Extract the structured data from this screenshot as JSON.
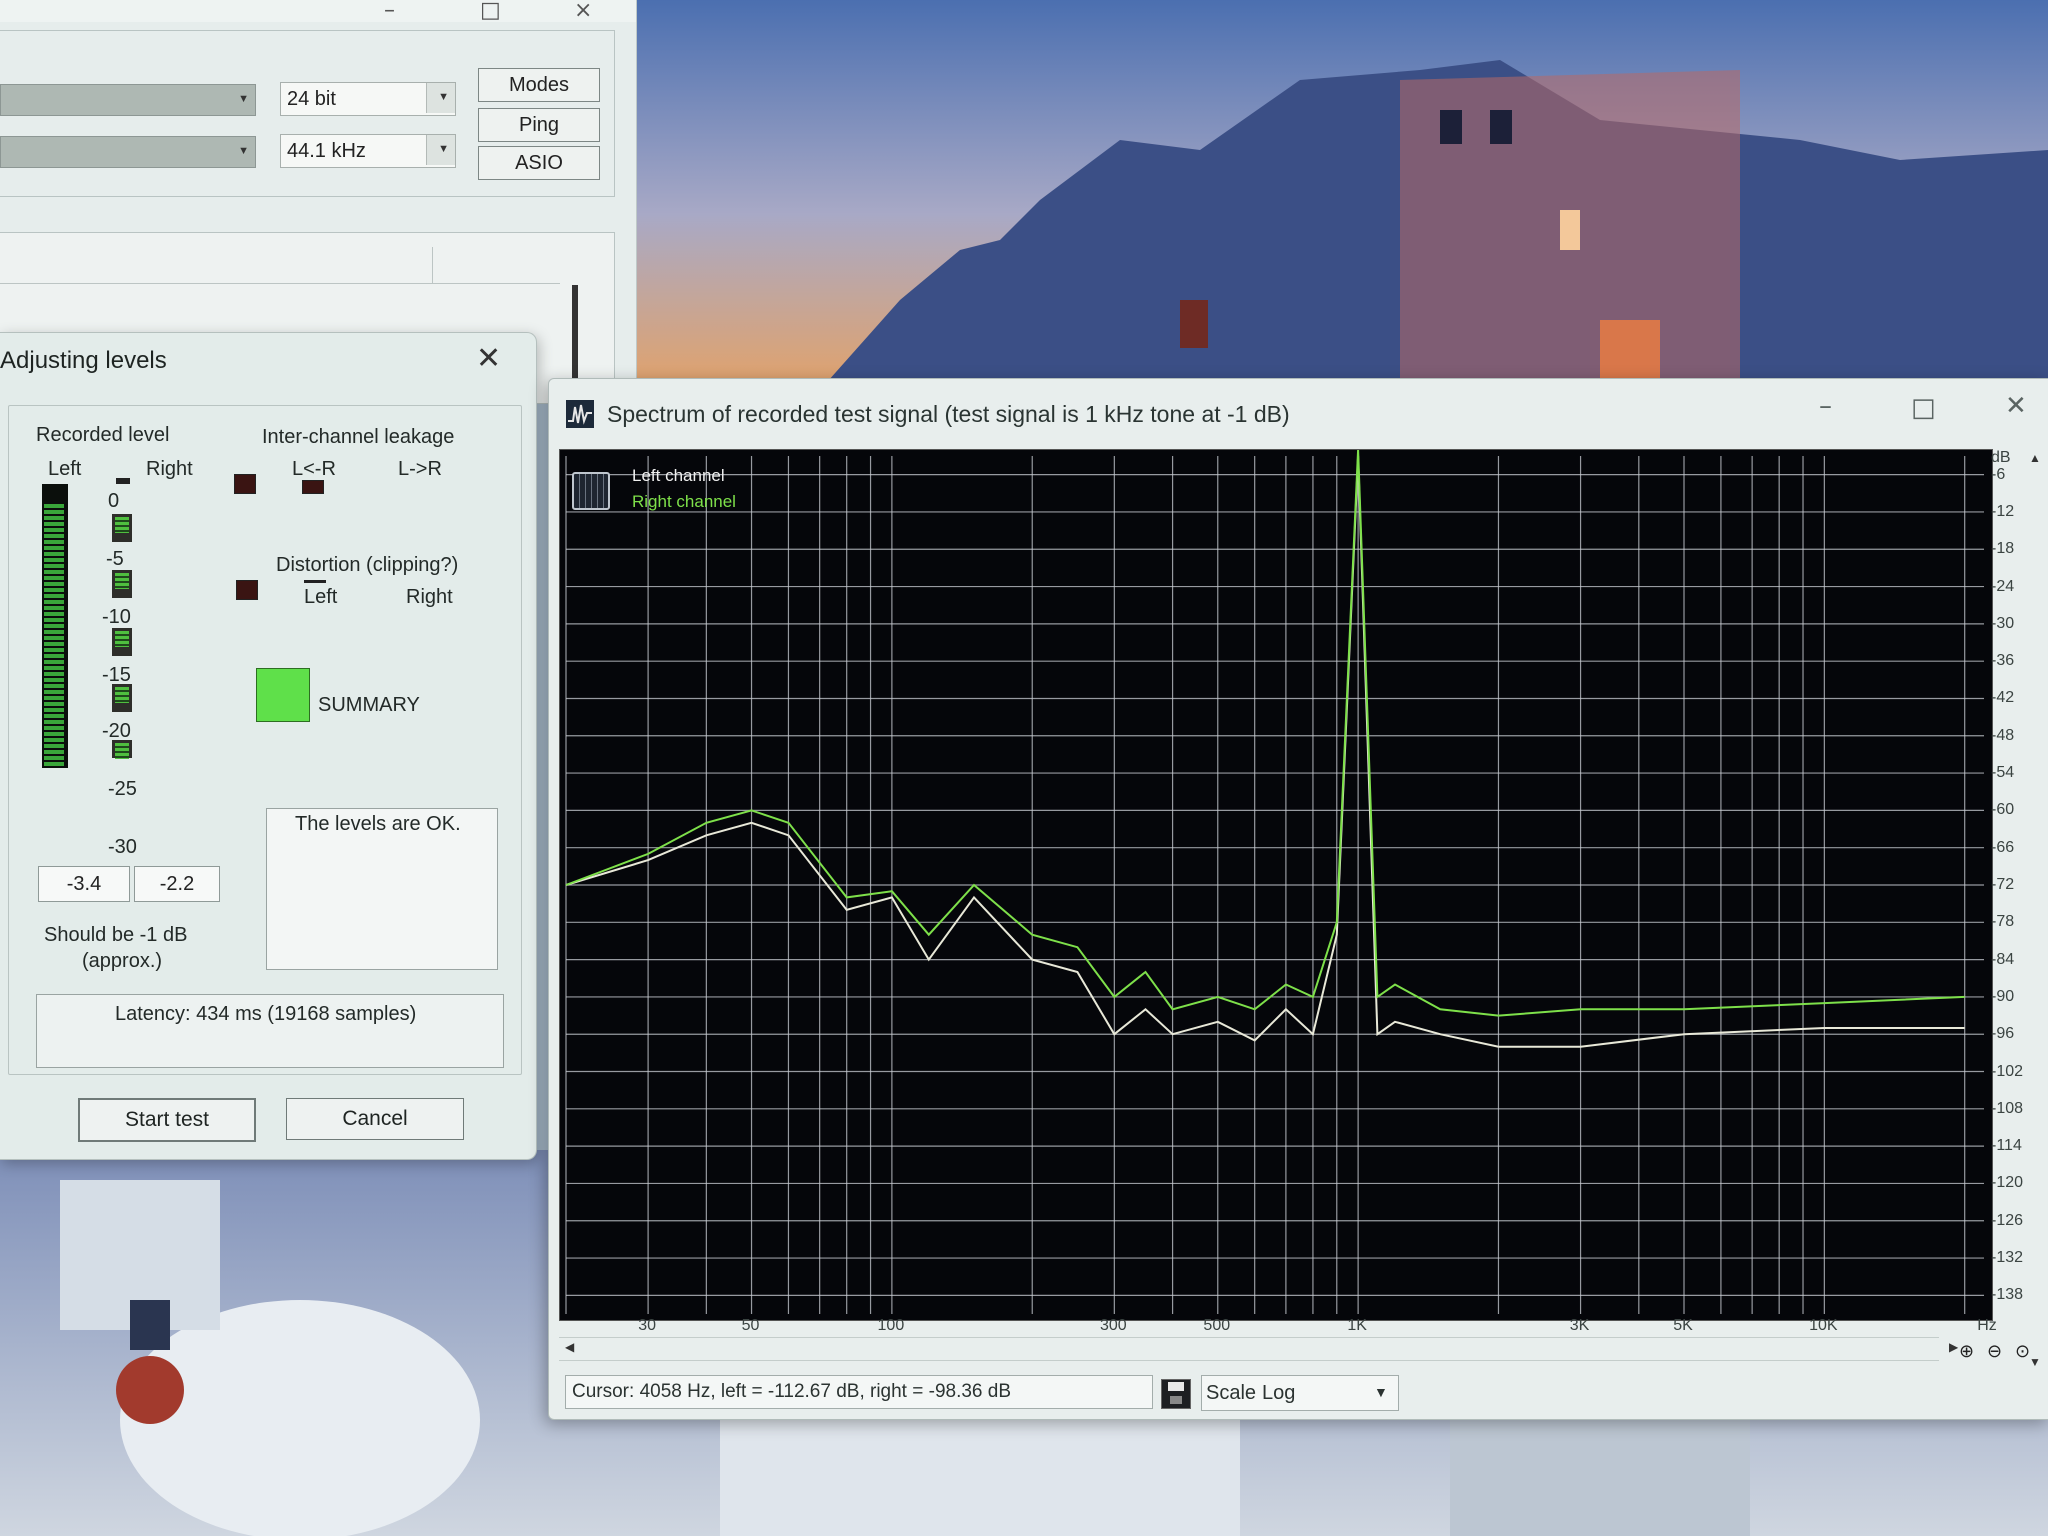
{
  "bg_window": {
    "bit_depth": "24 bit",
    "sample_rate": "44.1 kHz",
    "buttons": [
      "Modes",
      "Ping",
      "ASIO"
    ]
  },
  "adjust_dialog": {
    "title": "Adjusting levels",
    "recorded_level": "Recorded level",
    "left": "Left",
    "right": "Right",
    "scale": [
      "0",
      "-5",
      "-10",
      "-15",
      "-20",
      "-25",
      "-30"
    ],
    "left_value": "-3.4",
    "right_value": "-2.2",
    "should_be": "Should be  -1 dB",
    "approx": "(approx.)",
    "leakage_title": "Inter-channel leakage",
    "leakage_lr": "L<-R",
    "leakage_rl": "L->R",
    "distortion_title": "Distortion (clipping?)",
    "dist_left": "Left",
    "dist_right": "Right",
    "summary": "SUMMARY",
    "message": "The levels are OK.",
    "latency": "Latency: 434 ms (19168 samples)",
    "start_button": "Start test",
    "cancel_button": "Cancel"
  },
  "spectrum_window": {
    "title": "Spectrum of recorded test signal (test signal is 1 kHz tone at -1 dB)",
    "legend_left": "Left channel",
    "legend_right": "Right channel",
    "y_unit": "dB",
    "y_ticks": [
      "-6",
      "-12",
      "-18",
      "-24",
      "-30",
      "-36",
      "-42",
      "-48",
      "-54",
      "-60",
      "-66",
      "-72",
      "-78",
      "-84",
      "-90",
      "-96",
      "-102",
      "-108",
      "-114",
      "-120",
      "-126",
      "-132",
      "-138"
    ],
    "x_unit": "Hz",
    "x_ticks": [
      "30",
      "50",
      "100",
      "300",
      "500",
      "1K",
      "3K",
      "5K",
      "10K"
    ],
    "cursor_status": "Cursor:  4058 Hz,  left = -112.67 dB,  right = -98.36 dB",
    "scale_label": "Scale",
    "scale_value": "Log"
  },
  "chart_data": {
    "type": "line",
    "title": "Spectrum of recorded test signal (test signal is 1 kHz tone at -1 dB)",
    "xlabel": "Hz",
    "ylabel": "dB",
    "x_scale": "log",
    "xlim": [
      20,
      22000
    ],
    "ylim": [
      -141,
      -3
    ],
    "grid": true,
    "legend_placement": "top-left",
    "colors": {
      "left": "#e8e8d8",
      "right": "#7ee04a",
      "background": "#05060a",
      "grid": "#c8ccd2"
    },
    "series": [
      {
        "name": "Left channel",
        "x": [
          20,
          30,
          40,
          50,
          60,
          80,
          100,
          120,
          150,
          200,
          250,
          300,
          350,
          400,
          500,
          600,
          700,
          800,
          900,
          1000,
          1100,
          1200,
          1500,
          2000,
          3000,
          5000,
          10000,
          20000
        ],
        "y": [
          -72,
          -68,
          -64,
          -62,
          -64,
          -76,
          -74,
          -84,
          -74,
          -84,
          -86,
          -96,
          -92,
          -96,
          -94,
          -97,
          -92,
          -96,
          -80,
          -3,
          -96,
          -94,
          -96,
          -98,
          -98,
          -96,
          -95,
          -95
        ]
      },
      {
        "name": "Right channel",
        "x": [
          20,
          30,
          40,
          50,
          60,
          80,
          100,
          120,
          150,
          200,
          250,
          300,
          350,
          400,
          500,
          600,
          700,
          800,
          900,
          1000,
          1100,
          1200,
          1500,
          2000,
          3000,
          5000,
          10000,
          20000
        ],
        "y": [
          -72,
          -67,
          -62,
          -60,
          -62,
          -74,
          -73,
          -80,
          -72,
          -80,
          -82,
          -90,
          -86,
          -92,
          -90,
          -92,
          -88,
          -90,
          -78,
          -2,
          -90,
          -88,
          -92,
          -93,
          -92,
          -92,
          -91,
          -90
        ]
      }
    ]
  }
}
